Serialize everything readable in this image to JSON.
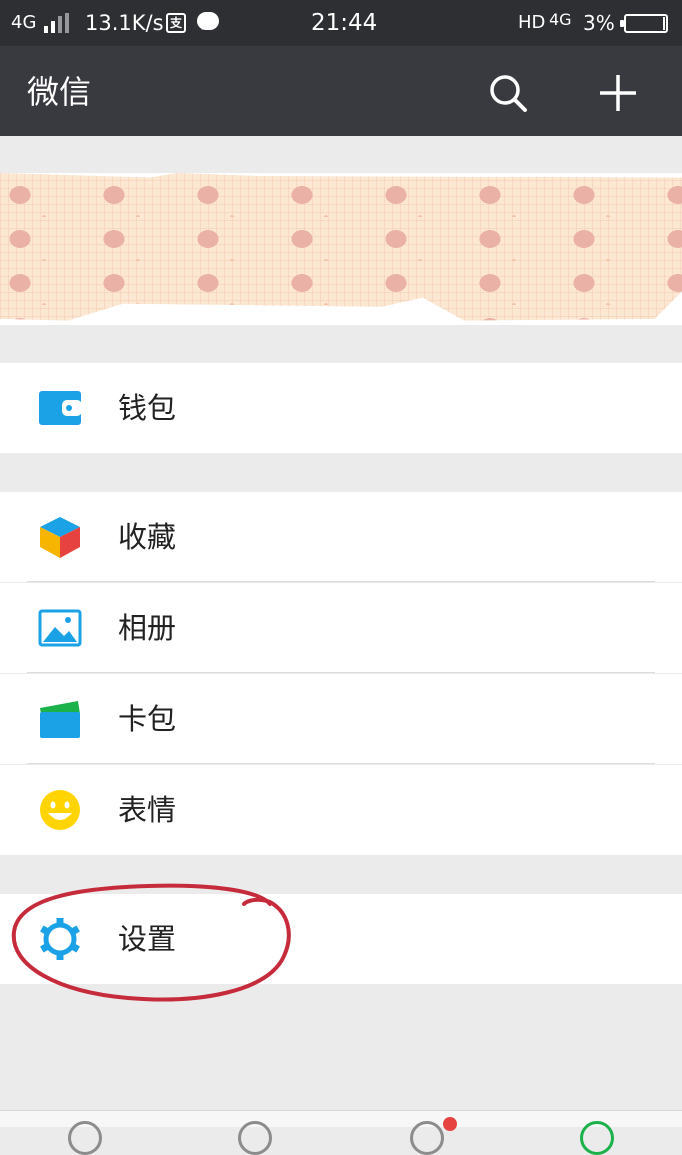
{
  "status_bar": {
    "network_left": "4G",
    "speed": "13.1K/s",
    "alipay_glyph": "支",
    "time": "21:44",
    "hd": "HD",
    "network_right": "4G",
    "battery": "3%"
  },
  "header": {
    "title": "微信",
    "search_icon": "search-icon",
    "add_icon": "plus-icon"
  },
  "menu": {
    "wallet": {
      "label": "钱包",
      "icon": "wallet-icon"
    },
    "favorites": {
      "label": "收藏",
      "icon": "cube-icon"
    },
    "album": {
      "label": "相册",
      "icon": "picture-icon"
    },
    "card_wallet": {
      "label": "卡包",
      "icon": "card-icon"
    },
    "stickers": {
      "label": "表情",
      "icon": "smile-icon"
    },
    "settings": {
      "label": "设置",
      "icon": "gear-icon"
    }
  },
  "colors": {
    "header_bg": "#393a3f",
    "status_bg": "#2e2f33",
    "wallet_blue": "#1aa1e6",
    "settings_blue": "#1aa1e6",
    "sticker_yellow": "#ffd400",
    "annotation_red": "#c62b3b"
  }
}
